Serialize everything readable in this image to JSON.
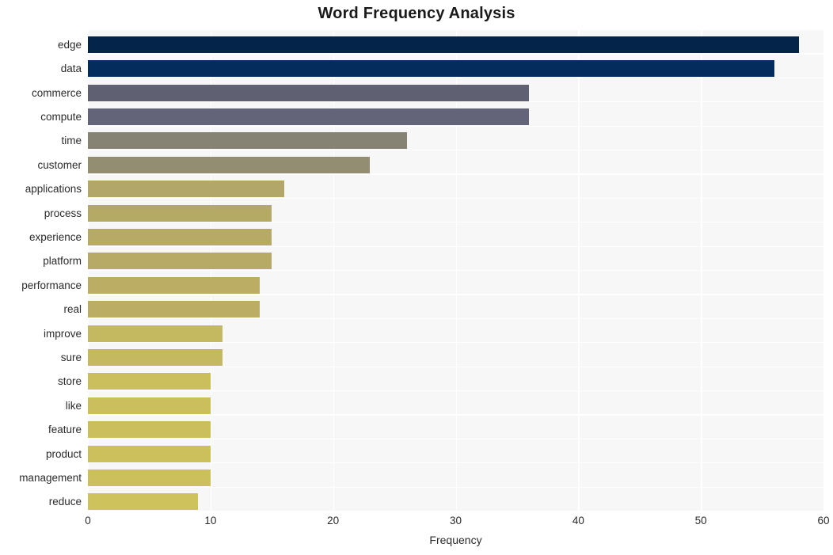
{
  "chart_data": {
    "type": "bar",
    "orientation": "horizontal",
    "title": "Word Frequency Analysis",
    "xlabel": "Frequency",
    "ylabel": "",
    "xlim": [
      0,
      60
    ],
    "xticks": [
      0,
      10,
      20,
      30,
      40,
      50,
      60
    ],
    "xtick_labels": [
      "0",
      "10",
      "20",
      "30",
      "40",
      "50",
      "60"
    ],
    "grid": true,
    "legend": null,
    "categories": [
      "edge",
      "data",
      "commerce",
      "compute",
      "time",
      "customer",
      "applications",
      "process",
      "experience",
      "platform",
      "performance",
      "real",
      "improve",
      "sure",
      "store",
      "like",
      "feature",
      "product",
      "management",
      "reduce"
    ],
    "values": [
      58,
      56,
      36,
      36,
      26,
      23,
      16,
      15,
      15,
      15,
      14,
      14,
      11,
      11,
      10,
      10,
      10,
      10,
      10,
      9
    ],
    "bar_colors": [
      "#05244a",
      "#042c5c",
      "#5f6071",
      "#63637a",
      "#868375",
      "#938e72",
      "#b2a669",
      "#b5a966",
      "#b6aa66",
      "#b6aa66",
      "#bbae64",
      "#bbae64",
      "#c4b860",
      "#c5b95f",
      "#cabe5d",
      "#cabe5d",
      "#cabe5d",
      "#ccc05d",
      "#ccc05d",
      "#cec25c"
    ],
    "plot_background": "#f7f7f7",
    "grid_color": "#ffffff",
    "figure_background": "#ffffff",
    "text_color": "#2b2b2b"
  }
}
